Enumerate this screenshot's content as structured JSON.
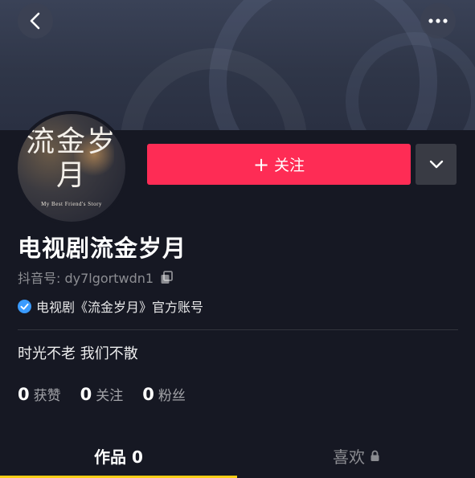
{
  "profile": {
    "avatar_text": "流金岁月",
    "avatar_subtitle": "My Best Friend's Story",
    "name": "电视剧流金岁月",
    "account_label": "抖音号: dy7lgortwdn1",
    "verified_text": "电视剧《流金岁月》官方账号",
    "bio": "时光不老  我们不散"
  },
  "actions": {
    "follow_label": "关注"
  },
  "stats": [
    {
      "value": "0",
      "label": "获赞"
    },
    {
      "value": "0",
      "label": "关注"
    },
    {
      "value": "0",
      "label": "粉丝"
    }
  ],
  "tabs": {
    "works_label": "作品 0",
    "likes_label": "喜欢"
  },
  "icons": {
    "back": "chevron-left-icon",
    "more": "more-dots-icon",
    "dropdown": "chevron-down-icon",
    "copy": "copy-icon",
    "verified": "verified-check-icon",
    "lock": "lock-icon"
  },
  "colors": {
    "follow": "#fe2c55",
    "tab_underline": "#face15",
    "verified": "#3a9bff",
    "background": "#161823"
  }
}
